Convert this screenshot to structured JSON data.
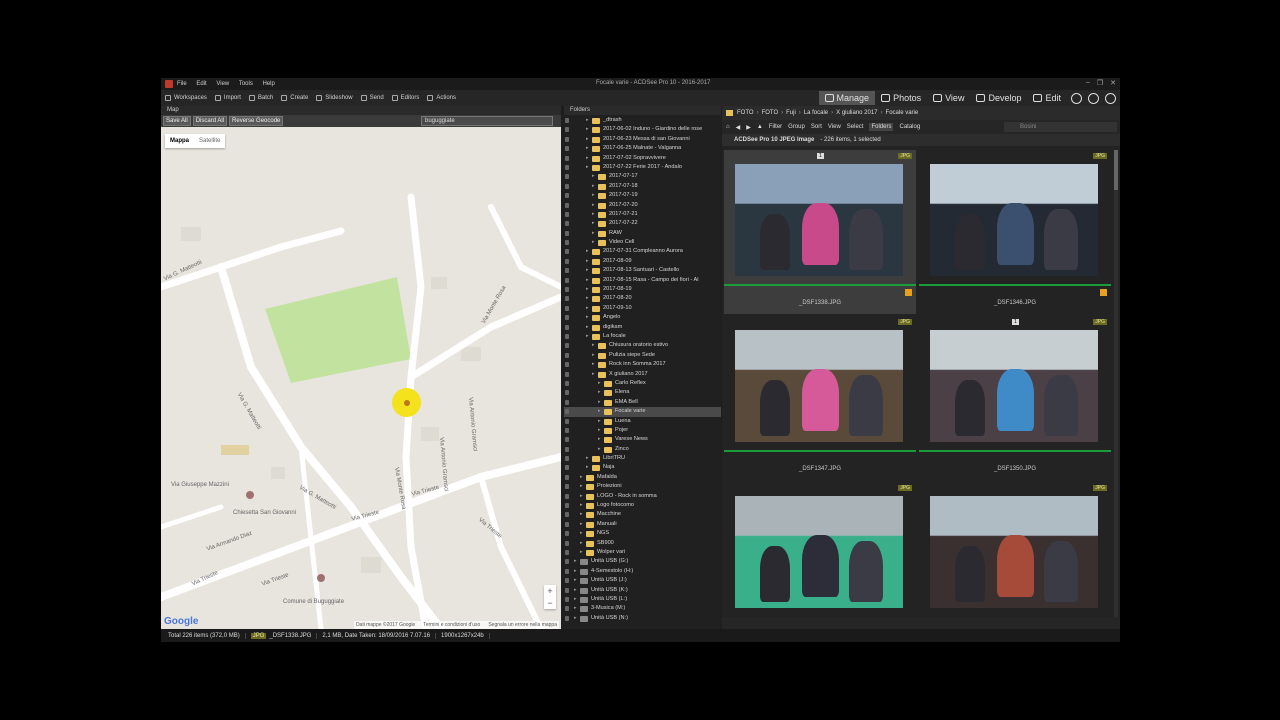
{
  "app": {
    "window_title": "Focale varie - ACDSee Pro 10 - 2016-2017",
    "menu": [
      "File",
      "Edit",
      "View",
      "Tools",
      "Help"
    ]
  },
  "toolbar": {
    "items": [
      "Workspaces",
      "Import",
      "Batch",
      "Create",
      "Slideshow",
      "Send",
      "Editors",
      "Actions"
    ]
  },
  "modes": [
    "Manage",
    "Photos",
    "View",
    "Develop",
    "Edit"
  ],
  "map": {
    "header": "Map",
    "buttons": [
      "Save All",
      "Discard All",
      "Reverse Geocode"
    ],
    "search_value": "buguggiate",
    "tabs": [
      "Mappa",
      "Satellite"
    ],
    "streets": [
      "Via G. Matteotti",
      "Via G. Matteotti",
      "Via Monte Rosa",
      "Via Antonio Gramsci",
      "Via Monte Rosa",
      "Via Antonio Gramsci",
      "Via Giuseppe Mazzini",
      "Chiesetta San Giovanni",
      "Via Armando Diaz",
      "Via Trieste",
      "Via Trieste",
      "Via Trieste",
      "Via Trieste",
      "Via Trieste",
      "Via G. Matteotti",
      "Comune di Buguggiate"
    ],
    "google": "Google",
    "copyright": [
      "Dati mappe ©2017 Google",
      "Termini e condizioni d'uso",
      "Segnala un errore nella mappa"
    ]
  },
  "folders": {
    "header": "Folders",
    "items": [
      {
        "label": "_dtrash",
        "level": 3
      },
      {
        "label": "2017-06-02 Induno - Giardino delle rose",
        "level": 3
      },
      {
        "label": "2017-06-23 Messa di san Giovanni",
        "level": 3
      },
      {
        "label": "2017-06-25 Malnate - Valganna",
        "level": 3
      },
      {
        "label": "2017-07-02 Sopravvivere",
        "level": 3
      },
      {
        "label": "2017-07-22 Ferie 2017 - Andalo",
        "level": 3
      },
      {
        "label": "2017-07-17",
        "level": 4
      },
      {
        "label": "2017-07-18",
        "level": 4
      },
      {
        "label": "2017-07-19",
        "level": 4
      },
      {
        "label": "2017-07-20",
        "level": 4
      },
      {
        "label": "2017-07-21",
        "level": 4
      },
      {
        "label": "2017-07-22",
        "level": 4
      },
      {
        "label": "RAW",
        "level": 4
      },
      {
        "label": "Video Cell",
        "level": 4
      },
      {
        "label": "2017-07-31 Compleanno Aurora",
        "level": 3
      },
      {
        "label": "2017-08-09",
        "level": 3
      },
      {
        "label": "2017-08-13 Santuari - Castello",
        "level": 3
      },
      {
        "label": "2017-08-15 Rasa - Campo dei fiori - Al",
        "level": 3
      },
      {
        "label": "2017-08-19",
        "level": 3
      },
      {
        "label": "2017-08-20",
        "level": 3
      },
      {
        "label": "2017-09-10",
        "level": 3
      },
      {
        "label": "Angelo",
        "level": 3
      },
      {
        "label": "digikam",
        "level": 3
      },
      {
        "label": "La focale",
        "level": 3
      },
      {
        "label": "Chiusura oratorio estivo",
        "level": 4
      },
      {
        "label": "Pulizia siepe Sede",
        "level": 4
      },
      {
        "label": "Rock inn Somma 2017",
        "level": 4
      },
      {
        "label": "X giuliano 2017",
        "level": 4
      },
      {
        "label": "Carlo Reflex",
        "level": 5
      },
      {
        "label": "Elena",
        "level": 5
      },
      {
        "label": "EMA Bell",
        "level": 5
      },
      {
        "label": "Focale varie",
        "level": 5
      },
      {
        "label": "Luena",
        "level": 5
      },
      {
        "label": "Pojer",
        "level": 5
      },
      {
        "label": "Varese News",
        "level": 5
      },
      {
        "label": "Zinco",
        "level": 5
      },
      {
        "label": "LibriTRU",
        "level": 3
      },
      {
        "label": "Naja",
        "level": 3
      },
      {
        "label": "Mafalda",
        "level": 2
      },
      {
        "label": "Proiezioni",
        "level": 2
      },
      {
        "label": "LOGO - Rock in somma",
        "level": 2
      },
      {
        "label": "Logo fotocomo",
        "level": 2
      },
      {
        "label": "Macchine",
        "level": 2
      },
      {
        "label": "Manuali",
        "level": 2
      },
      {
        "label": "NGS",
        "level": 2
      },
      {
        "label": "SB900",
        "level": 2
      },
      {
        "label": "Wolper vari",
        "level": 2
      },
      {
        "label": "Unità USB (G:)",
        "level": 1
      },
      {
        "label": "4-Semestolo (H:)",
        "level": 1
      },
      {
        "label": "Unità USB (J:)",
        "level": 1
      },
      {
        "label": "Unità USB (K:)",
        "level": 1
      },
      {
        "label": "Unità USB (L:)",
        "level": 1
      },
      {
        "label": "3-Musica (M:)",
        "level": 1
      },
      {
        "label": "Unità USB (N:)",
        "level": 1
      }
    ]
  },
  "browser": {
    "breadcrumb": [
      "FOTO",
      "FOTO",
      "Fuji",
      "La focale",
      "X giuliano 2017",
      "Focale varie"
    ],
    "filters": [
      "Filter",
      "Group",
      "Sort",
      "View",
      "Select",
      "Folders",
      "Catalog"
    ],
    "search_placeholder": "Bosini",
    "info_title": "ACDSee Pro 10 JPEG Image",
    "info_count": "- 226 items, 1 selected",
    "thumbs": [
      {
        "name": "_DSF1338.JPG",
        "badge": "JPG",
        "num": "1"
      },
      {
        "name": "_DSF1346.JPG",
        "badge": "JPG",
        "num": ""
      },
      {
        "name": "_DSF1347.JPG",
        "badge": "JPG",
        "num": ""
      },
      {
        "name": "_DSF1350.JPG",
        "badge": "JPG",
        "num": "1"
      },
      {
        "name": "",
        "badge": "JPG",
        "num": ""
      },
      {
        "name": "",
        "badge": "JPG",
        "num": ""
      }
    ]
  },
  "status": {
    "total": "Total 226 items  (372,0 MB)",
    "type": "JPG",
    "file": "_DSF1338.JPG",
    "info": "2,1 MB, Date Taken: 18/09/2016 7.07.16",
    "dims": "1900x1267x24b"
  }
}
